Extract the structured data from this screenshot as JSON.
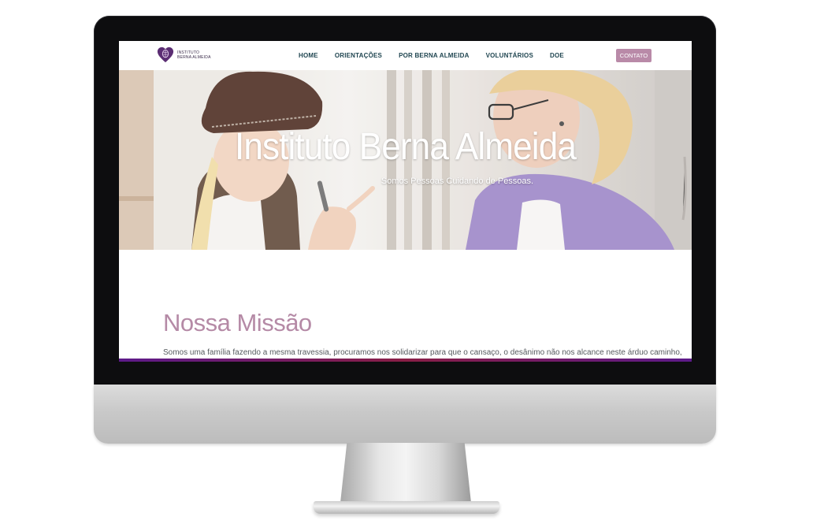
{
  "logo": {
    "line1": "INSTITUTO",
    "line2": "BERNA ALMEIDA"
  },
  "nav": {
    "items": [
      "HOME",
      "ORIENTAÇÕES",
      "POR BERNA ALMEIDA",
      "VOLUNTÁRIOS",
      "DOE"
    ],
    "contact_label": "CONTATO"
  },
  "hero": {
    "title": "Instituto Berna Almeida",
    "subtitle": "Somos Pessoas Cuidando de Pessoas."
  },
  "mission": {
    "title": "Nossa Missão",
    "text": "Somos uma família fazendo a mesma travessia, procuramos nos solidarizar para que o cansaço, o desânimo não nos alcance neste árduo caminho,"
  },
  "colors": {
    "accent": "#b98aa8",
    "mission_title": "#b58aa6",
    "nav_text": "#1f4550",
    "logo": "#5b2d73"
  }
}
